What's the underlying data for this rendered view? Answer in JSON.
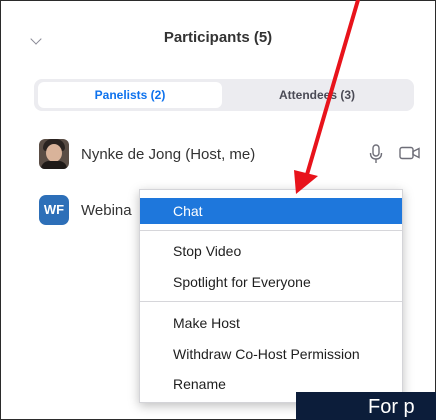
{
  "header": {
    "title": "Participants (5)"
  },
  "tabs": [
    {
      "label": "Panelists (2)",
      "active": true
    },
    {
      "label": "Attendees (3)",
      "active": false
    }
  ],
  "participants": [
    {
      "name": "Nynke de Jong (Host, me)",
      "avatar": "photo"
    },
    {
      "name": "Webina",
      "avatar_initials": "WF"
    }
  ],
  "context_menu": {
    "items": [
      "Chat",
      "Stop Video",
      "Spotlight for Everyone",
      "Make Host",
      "Withdraw Co-Host Permission",
      "Rename"
    ],
    "selected": "Chat"
  },
  "overlay": {
    "text": "For p"
  },
  "colors": {
    "accent": "#0e72ed",
    "selected": "#1e77dc",
    "annotation_arrow": "#e8131b",
    "avatar_wf": "#2d6fb8"
  }
}
